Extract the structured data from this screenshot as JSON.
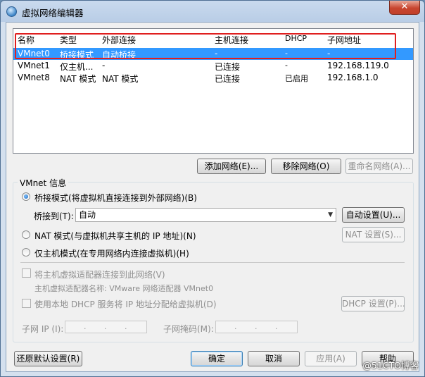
{
  "window": {
    "title": "虚拟网络编辑器",
    "close": "✕"
  },
  "networks": {
    "columns": [
      "名称",
      "类型",
      "外部连接",
      "主机连接",
      "DHCP",
      "子网地址"
    ],
    "rows": [
      [
        "VMnet0",
        "桥接模式",
        "自动桥接",
        "-",
        "-",
        "-"
      ],
      [
        "VMnet1",
        "仅主机...",
        "-",
        "已连接",
        "-",
        "192.168.119.0"
      ],
      [
        "VMnet8",
        "NAT 模式",
        "NAT 模式",
        "已连接",
        "已启用",
        "192.168.1.0"
      ]
    ],
    "selected_row": "VMnet0"
  },
  "list_buttons": {
    "add": "添加网络(E)...",
    "remove": "移除网络(O)",
    "rename": "重命名网络(A)..."
  },
  "info": {
    "title": "VMnet 信息",
    "bridged_radio": "桥接模式(将虚拟机直接连接到外部网络)(B)",
    "bridged_to_label": "桥接到(T):",
    "bridged_to_value": "自动",
    "auto_settings": "自动设置(U)...",
    "nat_radio": "NAT 模式(与虚拟机共享主机的 IP 地址)(N)",
    "nat_settings": "NAT 设置(S)...",
    "host_only_radio": "仅主机模式(在专用网络内连接虚拟机)(H)",
    "connect_adapter": "将主机虚拟适配器连接到此网络(V)",
    "adapter_name": "主机虚拟适配器名称: VMware 网络适配器 VMnet0",
    "use_dhcp": "使用本地 DHCP 服务将 IP 地址分配给虚拟机(D)",
    "dhcp_settings": "DHCP 设置(P)...",
    "subnet_ip_label": "子网 IP (I):",
    "subnet_mask_label": "子网掩码(M):",
    "ip_dot": "."
  },
  "footer": {
    "restore": "还原默认设置(R)",
    "ok": "确定",
    "cancel": "取消",
    "apply": "应用(A)",
    "help": "帮助"
  },
  "watermark": "@51CTO博客",
  "colors": {
    "selection": "#3399ff",
    "highlight_box": "#e01f1f",
    "title_bar": "#b9cde6"
  }
}
